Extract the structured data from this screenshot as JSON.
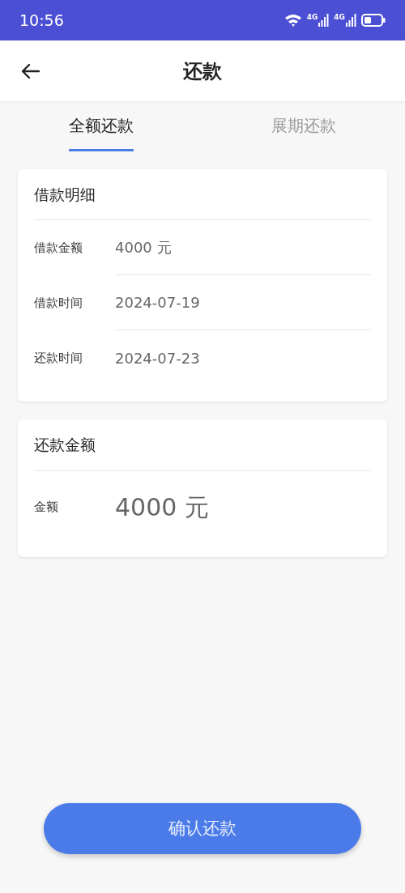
{
  "status_bar": {
    "time": "10:56",
    "networks": [
      "4G",
      "4G"
    ]
  },
  "header": {
    "title": "还款"
  },
  "tabs": [
    {
      "label": "全额还款",
      "selected": true
    },
    {
      "label": "展期还款",
      "selected": false
    }
  ],
  "loan_details": {
    "title": "借款明细",
    "rows": [
      {
        "label": "借款金额",
        "value": "4000 元"
      },
      {
        "label": "借款时间",
        "value": "2024-07-19"
      },
      {
        "label": "还款时间",
        "value": "2024-07-23"
      }
    ]
  },
  "repayment": {
    "title": "还款金额",
    "label": "金额",
    "value": "4000 元"
  },
  "confirm_button": "确认还款"
}
